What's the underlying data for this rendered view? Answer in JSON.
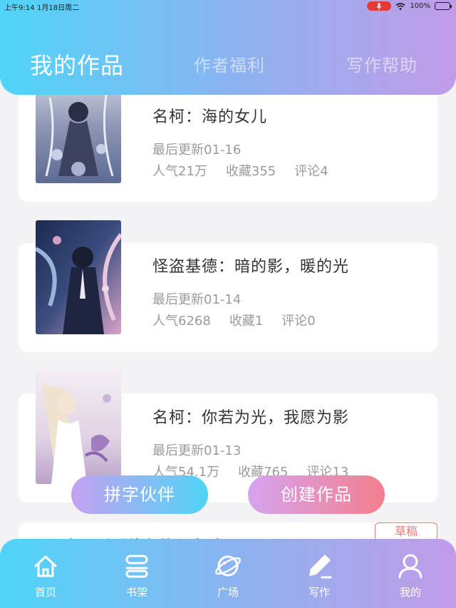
{
  "status_bar": {
    "time": "上午9:14",
    "date": "1月18日周二",
    "battery": "100%",
    "icons": [
      "microphone-icon",
      "wifi-icon",
      "battery-icon"
    ]
  },
  "tabs": [
    {
      "label": "我的作品",
      "active": true
    },
    {
      "label": "作者福利",
      "active": false
    },
    {
      "label": "写作帮助",
      "active": false
    }
  ],
  "works": [
    {
      "title": "名柯：海的女儿",
      "updated": "最后更新01-16",
      "popularity": "人气21万",
      "favorites": "收藏355",
      "comments": "评论4"
    },
    {
      "title": "怪盗基德：暗的影，暖的光",
      "updated": "最后更新01-14",
      "popularity": "人气6268",
      "favorites": "收藏1",
      "comments": "评论0"
    },
    {
      "title": "名柯：你若为光，我愿为影",
      "updated": "最后更新01-13",
      "popularity": "人气54.1万",
      "favorites": "收藏765",
      "comments": "评论13"
    }
  ],
  "draft": {
    "badge": "草稿",
    "title": "王者：瑶瑶俏在什么 捉之黑眼"
  },
  "actions": {
    "partner_label": "拼字伙伴",
    "create_label": "创建作品"
  },
  "bottom_nav": [
    {
      "label": "首页",
      "icon": "home-icon"
    },
    {
      "label": "书架",
      "icon": "bookshelf-icon"
    },
    {
      "label": "广场",
      "icon": "planet-icon"
    },
    {
      "label": "写作",
      "icon": "pen-icon",
      "active": true
    },
    {
      "label": "我的",
      "icon": "user-icon"
    }
  ],
  "colors": {
    "gradient_start": "#4fd4f8",
    "gradient_end": "#c19be8",
    "draft_accent": "#f07c7c"
  }
}
